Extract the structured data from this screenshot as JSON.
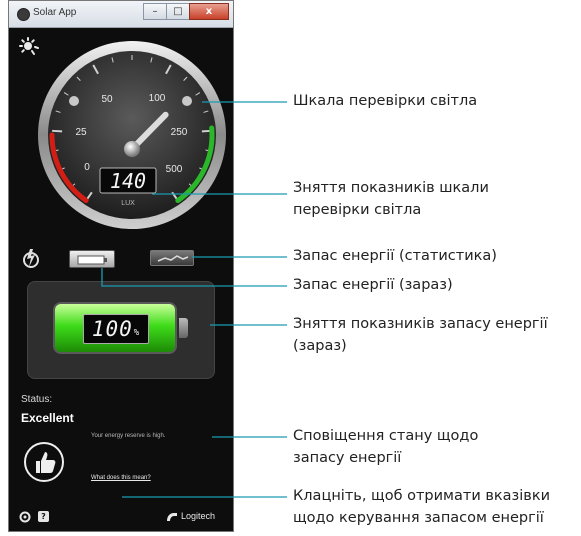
{
  "window": {
    "title": "Solar App",
    "controls": {
      "minimize": "–",
      "maximize": "□",
      "close": "x"
    }
  },
  "gauge": {
    "ticks": [
      "0",
      "25",
      "50",
      "100",
      "250",
      "500"
    ],
    "reading": "140",
    "unit": "LUX",
    "value": 140,
    "colors": {
      "low": "#d21e14",
      "high": "#2ab82a"
    }
  },
  "battery": {
    "reading": "100",
    "unit": "%",
    "level": 1.0,
    "color": "#3fdc1a"
  },
  "status": {
    "label": "Status:",
    "value": "Excellent",
    "message": "Your energy reserve is high.",
    "help_link": "What does this mean?"
  },
  "footer": {
    "info_label": "?",
    "brand": "Logitech"
  },
  "callouts": {
    "light_meter": "Шкала перевірки світла",
    "light_reading_line1": "Зняття показників шкали",
    "light_reading_line2": "перевірки світла",
    "reserve_history": "Запас енергії (статистика)",
    "reserve_now": "Запас енергії (зараз)",
    "reserve_reading_line1": "Зняття показників запасу енергії",
    "reserve_reading_line2": "(зараз)",
    "status_note_line1": "Сповіщення стану щодо",
    "status_note_line2": "запасу енергії",
    "help_line1": "Клацніть, щоб отримати вказівки",
    "help_line2": "щодо керування запасом енергії"
  }
}
